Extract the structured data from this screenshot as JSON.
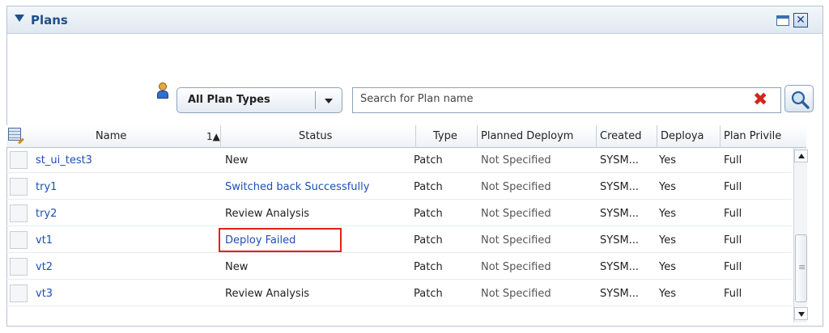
{
  "panel": {
    "title": "Plans"
  },
  "toolbar": {
    "type_filter": "All Plan Types",
    "search_placeholder": "Search for Plan name"
  },
  "table": {
    "columns": [
      "Name",
      "Status",
      "Type",
      "Planned Deploym",
      "Created",
      "Deploya",
      "Plan Privile"
    ],
    "sort_indicator": "1▲",
    "rows": [
      {
        "name": "st_ui_test3",
        "status": "New",
        "type": "Patch",
        "planned": "Not Specified",
        "created": "SYSM...",
        "deployable": "Yes",
        "privilege": "Full"
      },
      {
        "name": "try1",
        "status": "Switched back Successfully",
        "type": "Patch",
        "planned": "Not Specified",
        "created": "SYSM...",
        "deployable": "Yes",
        "privilege": "Full"
      },
      {
        "name": "try2",
        "status": "Review Analysis",
        "type": "Patch",
        "planned": "Not Specified",
        "created": "SYSM...",
        "deployable": "Yes",
        "privilege": "Full"
      },
      {
        "name": "vt1",
        "status": "Deploy Failed",
        "type": "Patch",
        "planned": "Not Specified",
        "created": "SYSM...",
        "deployable": "Yes",
        "privilege": "Full"
      },
      {
        "name": "vt2",
        "status": "New",
        "type": "Patch",
        "planned": "Not Specified",
        "created": "SYSM...",
        "deployable": "Yes",
        "privilege": "Full"
      },
      {
        "name": "vt3",
        "status": "Review Analysis",
        "type": "Patch",
        "planned": "Not Specified",
        "created": "SYSM...",
        "deployable": "Yes",
        "privilege": "Full"
      }
    ]
  },
  "colors": {
    "link": "#1b4fb3",
    "highlight": "#e0211b",
    "title": "#1f4f8c"
  }
}
